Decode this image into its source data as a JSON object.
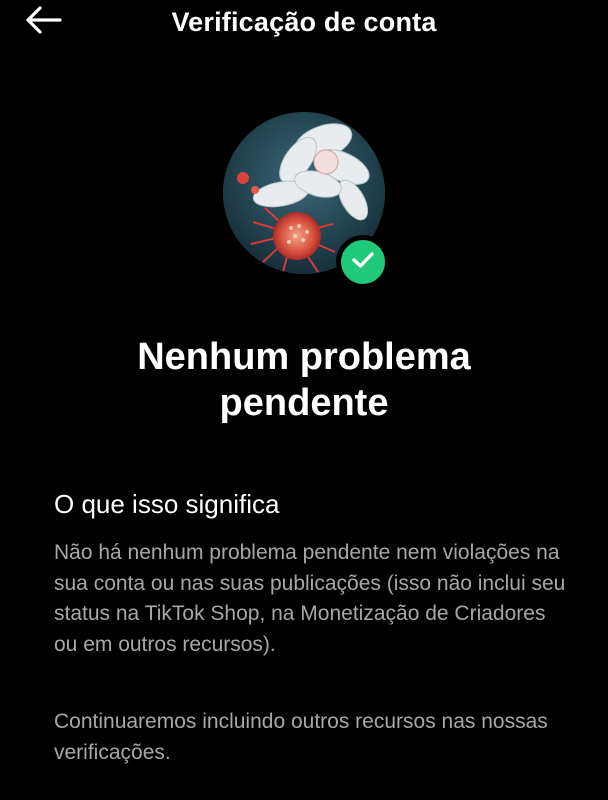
{
  "header": {
    "back_icon": "arrow-left-icon",
    "title": "Verificação de conta"
  },
  "status": {
    "badge_icon": "checkmark-icon",
    "badge_color": "#20c97a",
    "title": "Nenhum problema pendente"
  },
  "section": {
    "heading": "O que isso significa",
    "paragraph_1": "Não há nenhum problema pendente nem violações na sua conta ou nas suas publicações (isso não inclui seu status na TikTok Shop, na Monetização de Criadores ou em outros recursos).",
    "paragraph_2": "Continuaremos incluindo outros recursos nas nossas verificações."
  },
  "colors": {
    "background": "#000000",
    "text_primary": "#ffffff",
    "text_secondary": "#a7a7a7"
  }
}
